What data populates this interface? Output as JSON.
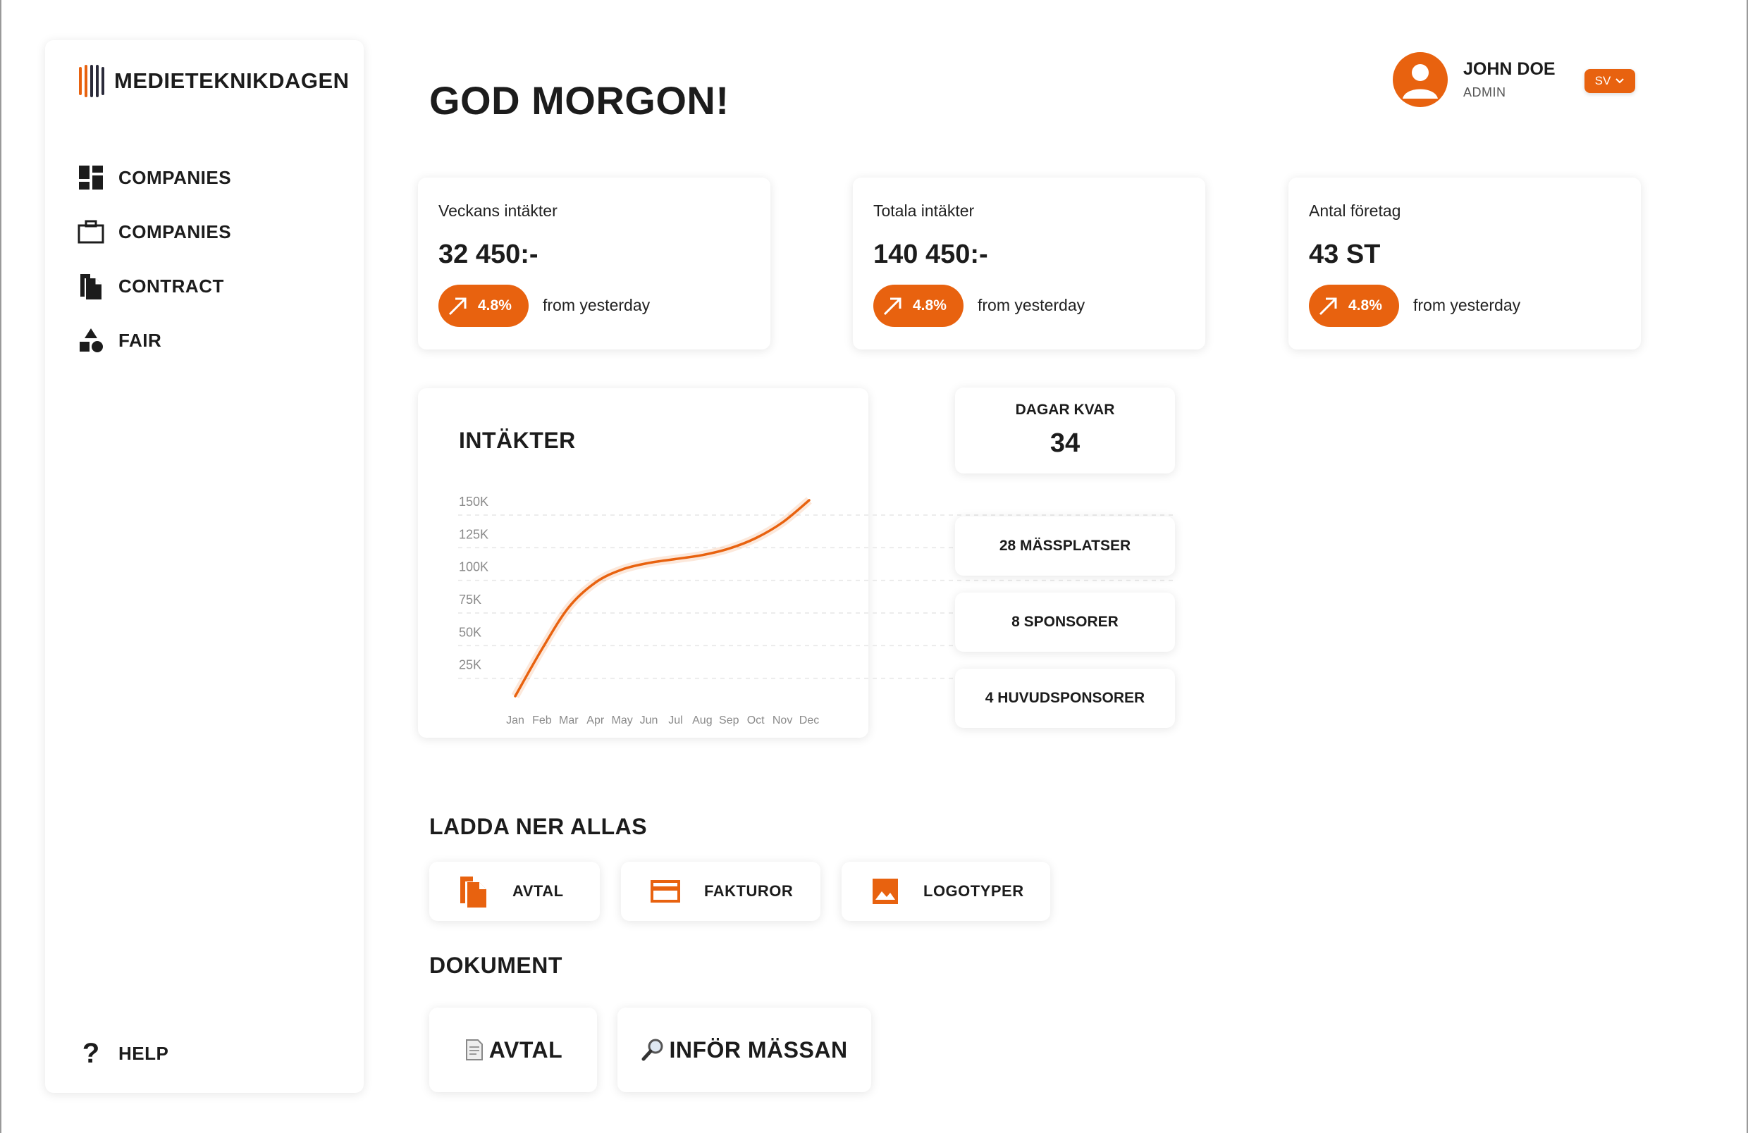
{
  "brand": {
    "name": "MEDIETEKNIKDAGEN",
    "accent": "#e8620f"
  },
  "sidebar": {
    "items": [
      {
        "label": "COMPANIES",
        "icon": "dashboard-icon"
      },
      {
        "label": "COMPANIES",
        "icon": "briefcase-icon"
      },
      {
        "label": "CONTRACT",
        "icon": "document-icon"
      },
      {
        "label": "FAIR",
        "icon": "shapes-icon"
      }
    ],
    "help": "HELP"
  },
  "header": {
    "greeting": "GOD MORGON!",
    "user_name": "JOHN DOE",
    "user_role": "ADMIN",
    "language": "SV"
  },
  "stats": [
    {
      "label": "Veckans intäkter",
      "value": "32 450:-",
      "change": "4.8%",
      "note": "from yesterday"
    },
    {
      "label": "Totala intäkter",
      "value": "140 450:-",
      "change": "4.8%",
      "note": "from yesterday"
    },
    {
      "label": "Antal företag",
      "value": "43 ST",
      "change": "4.8%",
      "note": "from yesterday"
    }
  ],
  "chart": {
    "title": "INTÄKTER"
  },
  "chart_data": {
    "type": "line",
    "title": "INTÄKTER",
    "categories": [
      "Jan",
      "Feb",
      "Mar",
      "Apr",
      "May",
      "Jun",
      "Jul",
      "Aug",
      "Sep",
      "Oct",
      "Nov",
      "Dec"
    ],
    "y_ticks": [
      "150K",
      "125K",
      "100K",
      "75K",
      "50K",
      "25K"
    ],
    "ylim": [
      0,
      150000
    ],
    "series": [
      {
        "values": [
          0,
          36000,
          68000,
          87000,
          97000,
          102000,
          105000,
          108000,
          113000,
          121000,
          133000,
          150000
        ],
        "color": "#e8620f"
      }
    ],
    "grid": true,
    "grid_style": "dashed"
  },
  "days_left": {
    "label": "DAGAR KVAR",
    "value": "34"
  },
  "info_boxes": [
    "28 MÄSSPLATSER",
    "8 SPONSORER",
    "4 HUVUDSPONSORER"
  ],
  "downloads": {
    "title": "LADDA NER ALLAS",
    "items": [
      {
        "label": "AVTAL",
        "icon": "document-icon"
      },
      {
        "label": "FAKTUROR",
        "icon": "credit-card-icon"
      },
      {
        "label": "LOGOTYPER",
        "icon": "image-icon"
      }
    ]
  },
  "documents": {
    "title": "DOKUMENT",
    "items": [
      {
        "label": "AVTAL",
        "icon": "page-icon"
      },
      {
        "label": "INFÖR MÄSSAN",
        "icon": "magnifier-icon"
      }
    ]
  }
}
